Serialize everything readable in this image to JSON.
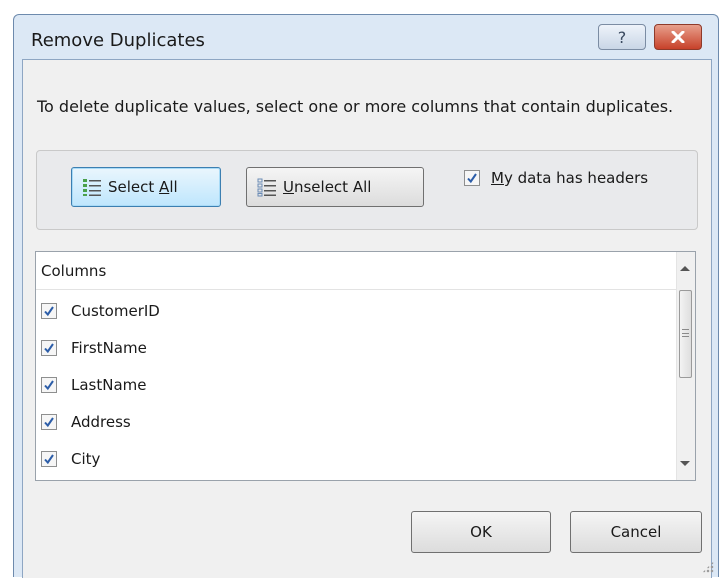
{
  "dialog": {
    "title": "Remove Duplicates",
    "help_glyph": "?",
    "close_icon": "close-icon"
  },
  "instruction": "To delete duplicate values, select one or more columns that contain duplicates.",
  "buttons": {
    "select_all_pre": "Select ",
    "select_all_key": "A",
    "select_all_post": "ll",
    "unselect_all_key": "U",
    "unselect_all_post": "nselect All",
    "ok": "OK",
    "cancel": "Cancel"
  },
  "headers_checkbox": {
    "label_key": "M",
    "label_post": "y data has headers",
    "checked": true
  },
  "columns_list": {
    "header": "Columns",
    "items": [
      {
        "label": "CustomerID",
        "checked": true
      },
      {
        "label": "FirstName",
        "checked": true
      },
      {
        "label": "LastName",
        "checked": true
      },
      {
        "label": "Address",
        "checked": true
      },
      {
        "label": "City",
        "checked": true
      }
    ]
  },
  "colors": {
    "dialog_frame": "#dce8f5",
    "client_bg": "#f0f0f0",
    "close_button": "#c7412a",
    "focus_button": "#bee6fd",
    "check_mark": "#2c5da8"
  }
}
